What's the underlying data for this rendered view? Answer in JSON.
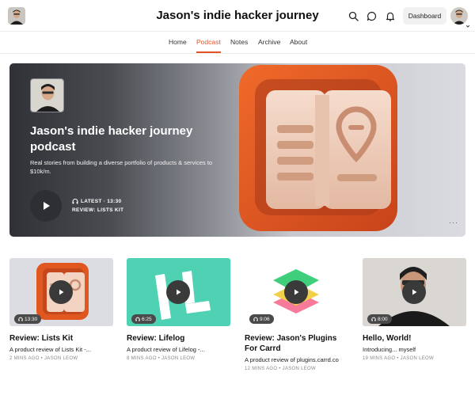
{
  "header": {
    "title": "Jason's indie hacker journey",
    "dashboard_label": "Dashboard"
  },
  "nav": {
    "items": [
      {
        "label": "Home"
      },
      {
        "label": "Podcast"
      },
      {
        "label": "Notes"
      },
      {
        "label": "Archive"
      },
      {
        "label": "About"
      }
    ],
    "active": "Podcast"
  },
  "hero": {
    "title": "Jason's indie hacker journey podcast",
    "description": "Real stories from building a diverse portfolio of products & services to $10k/m.",
    "latest": "LATEST · 13:30",
    "episode": "REVIEW: LISTS KIT",
    "more": "···"
  },
  "cards": [
    {
      "title": "Review: Lists Kit",
      "description": "A product review of Lists Kit -...",
      "meta": "2 MINS AGO • JASON LEOW",
      "duration": "13:30",
      "thumb": "lists-kit-art"
    },
    {
      "title": "Review: Lifelog",
      "description": "A product review of Lifelog -...",
      "meta": "8 MINS AGO • JASON LEOW",
      "duration": "6:25",
      "thumb": "lifelog-art"
    },
    {
      "title": "Review: Jason's Plugins For Carrd",
      "description": "A product review of plugins.carrd.co",
      "meta": "12 MINS AGO • JASON LEOW",
      "duration": "9:06",
      "thumb": "plugins-art"
    },
    {
      "title": "Hello, World!",
      "description": "Introducing... myself",
      "meta": "19 MINS AGO • JASON LEOW",
      "duration": "8:00",
      "thumb": "portrait-photo"
    }
  ],
  "colors": {
    "accent": "#e2552a",
    "lifelog_bg": "#4fd1b4",
    "orange_art": "#e0541f"
  }
}
